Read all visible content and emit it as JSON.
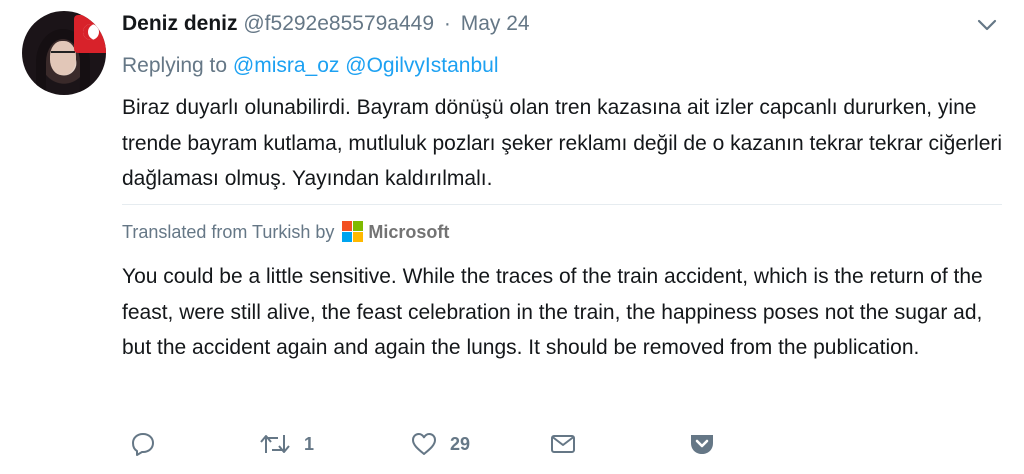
{
  "tweet": {
    "fullname": "Deniz deniz",
    "screen_name": "@f5292e85579a449",
    "separator": "·",
    "date": "May 24",
    "replying_prefix": "Replying to",
    "reply_to": [
      "@misra_oz",
      "@OgilvyIstanbul"
    ],
    "text": "Biraz duyarlı olunabilirdi. Bayram dönüşü olan tren kazasına ait izler capcanlı dururken, yine trende bayram kutlama, mutluluk pozları şeker reklamı değil de o kazanın tekrar tekrar ciğerleri dağlaması olmuş. Yayından kaldırılmalı.",
    "translation": {
      "label": "Translated from Turkish by",
      "provider": "Microsoft",
      "text": "You could be a little sensitive. While the traces of the train accident, which is the return of the feast, were still alive, the feast celebration in the train, the happiness poses not the sugar ad, but the accident again and again the lungs. It should be removed from the publication."
    }
  },
  "actions": {
    "reply_count": "",
    "retweet_count": "1",
    "like_count": "29"
  },
  "icons": {
    "reply": "reply-icon",
    "retweet": "retweet-icon",
    "like": "heart-icon",
    "dm": "envelope-icon",
    "pocket": "pocket-icon",
    "caret": "chevron-down-icon",
    "translator_logo": "microsoft-logo"
  },
  "colors": {
    "link": "#1da1f2",
    "secondary_text": "#657786",
    "primary_text": "#14171a",
    "icon": "#657786",
    "divider": "#e6ecf0"
  }
}
